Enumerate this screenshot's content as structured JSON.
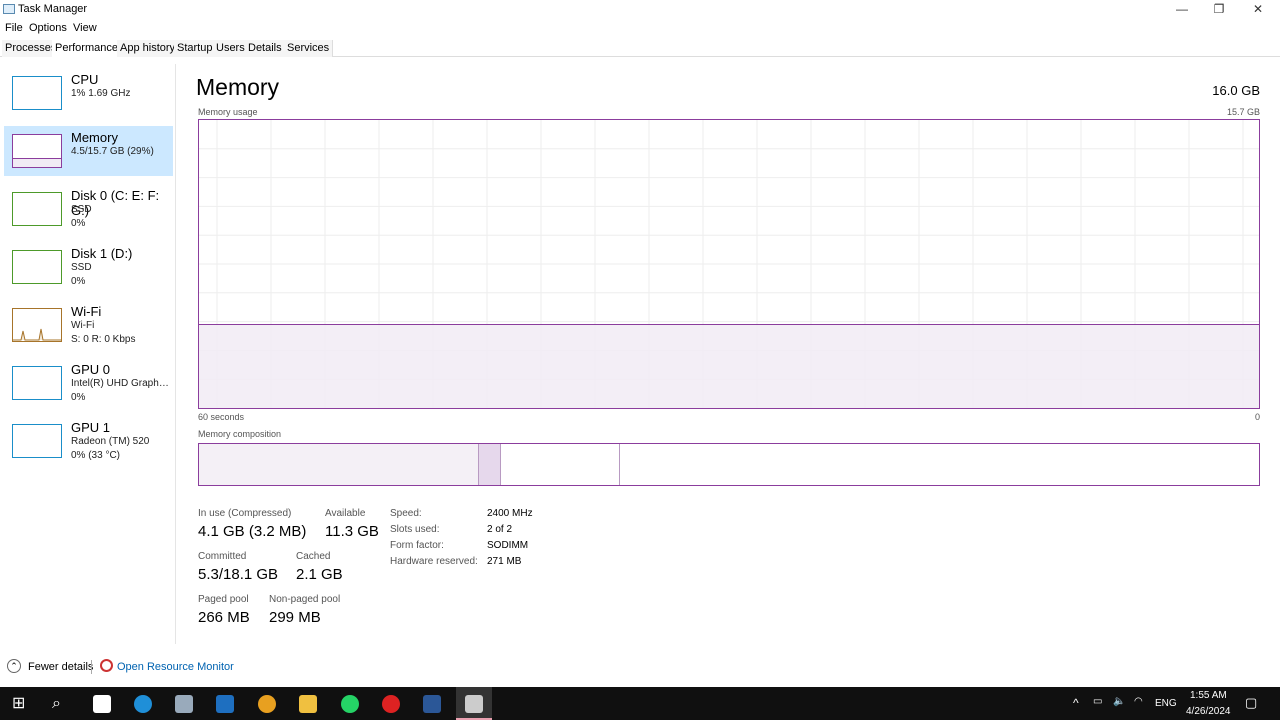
{
  "window": {
    "title": "Task Manager",
    "minimize": "—",
    "maximize": "❐",
    "close": "✕"
  },
  "menu": [
    "File",
    "Options",
    "View"
  ],
  "tabs": [
    "Processes",
    "Performance",
    "App history",
    "Startup",
    "Users",
    "Details",
    "Services"
  ],
  "active_tab": "Performance",
  "sidebar": [
    {
      "name": "CPU",
      "sub1": "1% 1.69 GHz",
      "sub2": "",
      "color": "#1a8ec9"
    },
    {
      "name": "Memory",
      "sub1": "4.5/15.7 GB (29%)",
      "sub2": "",
      "color": "#8b3d9d"
    },
    {
      "name": "Disk 0 (C: E: F: G:)",
      "sub1": "SSD",
      "sub2": "0%",
      "color": "#4d9a2a"
    },
    {
      "name": "Disk 1 (D:)",
      "sub1": "SSD",
      "sub2": "0%",
      "color": "#4d9a2a"
    },
    {
      "name": "Wi-Fi",
      "sub1": "Wi-Fi",
      "sub2": "S: 0 R: 0 Kbps",
      "color": "#a7742a"
    },
    {
      "name": "GPU 0",
      "sub1": "Intel(R) UHD Graphic...",
      "sub2": "0%",
      "color": "#1a8ec9"
    },
    {
      "name": "GPU 1",
      "sub1": "Radeon (TM) 520",
      "sub2": "0% (33 °C)",
      "color": "#1a8ec9"
    }
  ],
  "main": {
    "title": "Memory",
    "total": "16.0 GB",
    "usage_label": "Memory usage",
    "usage_max": "15.7 GB",
    "time_left": "60 seconds",
    "time_right": "0",
    "usage_percent": 29,
    "composition_label": "Memory composition",
    "stats": [
      {
        "label": "In use (Compressed)",
        "value": "4.1 GB (3.2 MB)"
      },
      {
        "label": "Available",
        "value": "11.3 GB"
      },
      {
        "label": "Committed",
        "value": "5.3/18.1 GB"
      },
      {
        "label": "Cached",
        "value": "2.1 GB"
      },
      {
        "label": "Paged pool",
        "value": "266 MB"
      },
      {
        "label": "Non-paged pool",
        "value": "299 MB"
      }
    ],
    "props": [
      {
        "label": "Speed:",
        "value": "2400 MHz"
      },
      {
        "label": "Slots used:",
        "value": "2 of 2"
      },
      {
        "label": "Form factor:",
        "value": "SODIMM"
      },
      {
        "label": "Hardware reserved:",
        "value": "271 MB"
      }
    ]
  },
  "footer": {
    "fewer": "Fewer details",
    "monitor": "Open Resource Monitor"
  },
  "taskbar": {
    "lang": "ENG",
    "time": "1:55 AM",
    "date": "4/26/2024"
  }
}
